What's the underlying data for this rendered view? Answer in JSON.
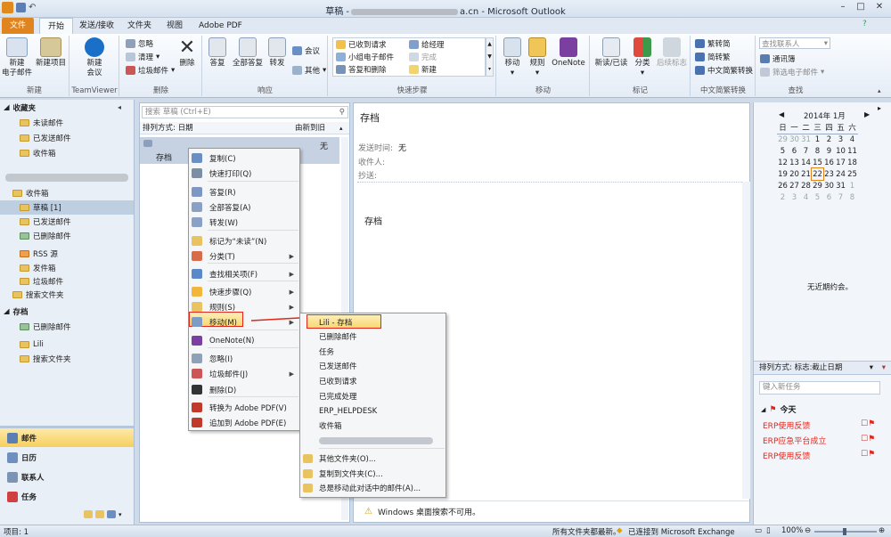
{
  "window": {
    "title_left": "草稿 -",
    "title_right": "a.cn - Microsoft Outlook",
    "quick_access": [
      "save",
      "undo"
    ]
  },
  "tabs": [
    "文件",
    "开始",
    "发送/接收",
    "文件夹",
    "视图",
    "Adobe PDF"
  ],
  "ribbon": {
    "new": {
      "new_email": "新建\n电子邮件",
      "new_items": "新建项目",
      "label": "新建"
    },
    "teamviewer": {
      "new_meeting": "新建\n会议",
      "label": "TeamViewer"
    },
    "delete": {
      "ignore": "忽略",
      "clean": "清理",
      "junk": "垃圾邮件",
      "delete": "删除",
      "label": "删除"
    },
    "respond": {
      "reply": "答复",
      "reply_all": "全部答复",
      "forward": "转发",
      "meeting": "会议",
      "more": "其他",
      "label": "响应"
    },
    "quick_steps": {
      "items": [
        "已收到请求",
        "小组电子邮件",
        "答复和删除",
        "给经理",
        "完成",
        "新建"
      ],
      "label": "快速步骤"
    },
    "move": {
      "move": "移动",
      "rules": "规则",
      "onenote": "OneNote",
      "label": "移动"
    },
    "tags": {
      "read_unread": "新读/已读",
      "categorize": "分类",
      "followup": "后续标志",
      "label": "标记"
    },
    "conv": {
      "t2s": "繁转简",
      "s2t": "简转繁",
      "conv": "中文简繁转换",
      "label": "中文简繁转换"
    },
    "find": {
      "search_contacts": "查找联系人",
      "address_book": "通讯簿",
      "filter": "筛选电子邮件",
      "label": "查找"
    }
  },
  "nav": {
    "favorites": "收藏夹",
    "fav_items": [
      "未读邮件",
      "已发送邮件",
      "收件箱"
    ],
    "folders": [
      "收件箱",
      "草稿 [1]",
      "已发送邮件",
      "已删除邮件",
      "RSS 源",
      "发件箱",
      "垃圾邮件",
      "搜索文件夹"
    ],
    "archive": "存档",
    "archive_items": [
      "已删除邮件",
      "Lili",
      "搜索文件夹"
    ],
    "modules": [
      "邮件",
      "日历",
      "联系人",
      "任务"
    ]
  },
  "list": {
    "search_placeholder": "搜索 草稿 (Ctrl+E)",
    "sort_by": "排列方式: 日期",
    "order": "由新到旧",
    "item_subject": "存档",
    "item_date": "无"
  },
  "reading": {
    "subject": "存档",
    "sent_label": "发送时间:",
    "sent_value": "无",
    "to_label": "收件人:",
    "cc_label": "抄送:",
    "body": "存档",
    "footer": "Windows 桌面搜索不可用。"
  },
  "context_menu": [
    "复制(C)",
    "快速打印(Q)",
    "答复(R)",
    "全部答复(A)",
    "转发(W)",
    "标记为“未读”(N)",
    "分类(T)",
    "查找相关项(F)",
    "快速步骤(Q)",
    "规则(S)",
    "移动(M)",
    "OneNote(N)",
    "忽略(I)",
    "垃圾邮件(J)",
    "删除(D)",
    "转换为 Adobe PDF(V)",
    "追加到 Adobe PDF(E)"
  ],
  "submenu": [
    "Lili - 存档",
    "已删除邮件",
    "任务",
    "已发送邮件",
    "已收到请求",
    "已完成处理",
    "ERP_HELPDESK",
    "收件箱",
    "其他文件夹(O)...",
    "复制到文件夹(C)...",
    "总是移动此对话中的邮件(A)..."
  ],
  "calendar": {
    "month": "2014年 1月",
    "weekdays": [
      "日",
      "一",
      "二",
      "三",
      "四",
      "五",
      "六"
    ],
    "weeks": [
      [
        "29",
        "30",
        "31",
        "1",
        "2",
        "3",
        "4"
      ],
      [
        "5",
        "6",
        "7",
        "8",
        "9",
        "10",
        "11"
      ],
      [
        "12",
        "13",
        "14",
        "15",
        "16",
        "17",
        "18"
      ],
      [
        "19",
        "20",
        "21",
        "22",
        "23",
        "24",
        "25"
      ],
      [
        "26",
        "27",
        "28",
        "29",
        "30",
        "31",
        "1"
      ],
      [
        "2",
        "3",
        "4",
        "5",
        "6",
        "7",
        "8"
      ]
    ],
    "today": "22",
    "no_appointments": "无近期约会。"
  },
  "tasks": {
    "sort": "排列方式: 标志:截止日期",
    "new_task": "键入新任务",
    "today": "今天",
    "items": [
      "ERP使用反馈",
      "ERP应急平台成立",
      "ERP使用反馈"
    ]
  },
  "status": {
    "items": "项目: 1",
    "updated": "所有文件夹都最新。",
    "connected": "已连接到 Microsoft Exchange",
    "zoom": "100%"
  },
  "colors": {
    "accent": "#e0841f",
    "select": "#ffe48c",
    "red": "#e3261b"
  }
}
